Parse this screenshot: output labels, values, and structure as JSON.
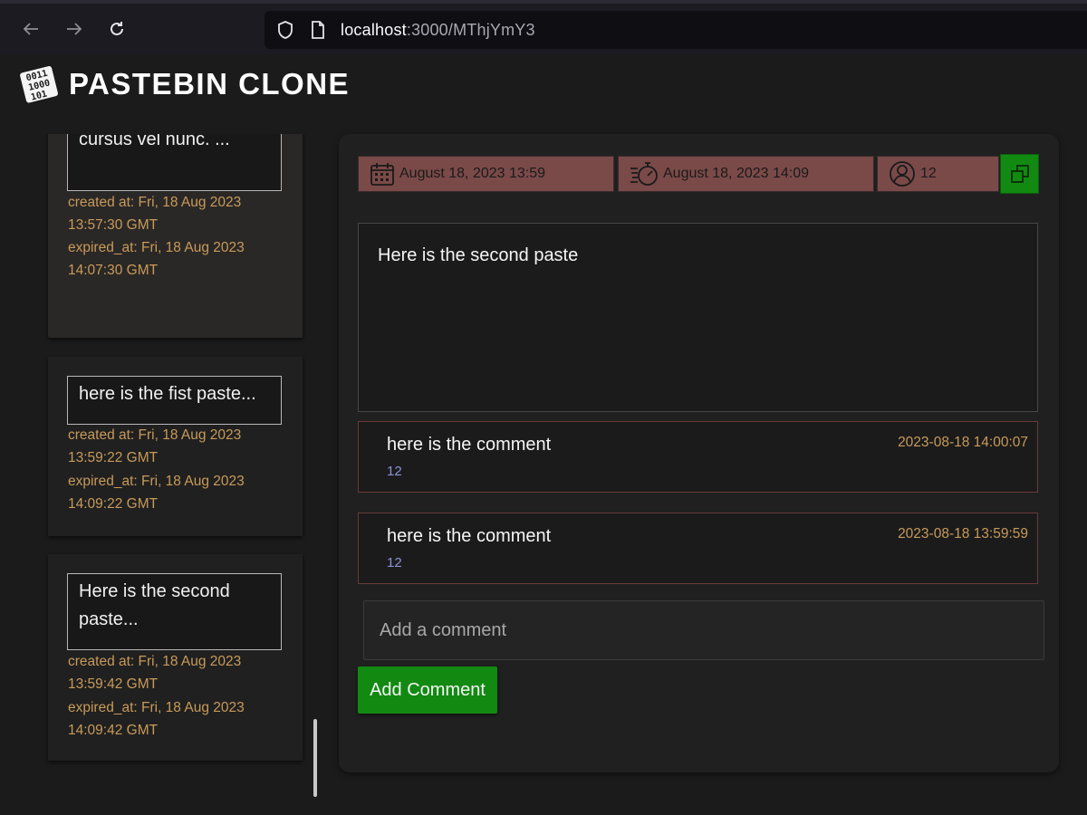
{
  "browser": {
    "url_host": "localhost",
    "url_rest": ":3000/MThjYmY3"
  },
  "header": {
    "logo_text": [
      "0011",
      "1000",
      "101"
    ],
    "title": "PASTEBIN CLONE"
  },
  "sidebar": {
    "cards": [
      {
        "preview": "sodales at aliquam nec, cursus vel nunc. ...",
        "created": "created at: Fri, 18 Aug 2023 13:57:30 GMT",
        "expired": "expired_at: Fri, 18 Aug 2023 14:07:30 GMT"
      },
      {
        "preview": "here is the fist paste...",
        "created": "created at: Fri, 18 Aug 2023 13:59:22 GMT",
        "expired": "expired_at: Fri, 18 Aug 2023 14:09:22 GMT"
      },
      {
        "preview": "Here is the second paste...",
        "created": "created at: Fri, 18 Aug 2023 13:59:42 GMT",
        "expired": "expired_at: Fri, 18 Aug 2023 14:09:42 GMT"
      }
    ]
  },
  "paste": {
    "created_date": "August 18, 2023 13:59",
    "expire_date": "August 18, 2023 14:09",
    "author": "12",
    "content": "Here is the second paste"
  },
  "comments": [
    {
      "text": "here is the comment",
      "author": "12",
      "time": "2023-08-18 14:00:07"
    },
    {
      "text": "here is the comment",
      "author": "12",
      "time": "2023-08-18 13:59:59"
    }
  ],
  "comment_form": {
    "placeholder": "Add a comment",
    "submit_label": "Add Comment"
  },
  "colors": {
    "chip": "#7a4a48",
    "accent_green": "#128a12",
    "meta": "#c89a5a",
    "author": "#8a94d8"
  },
  "icons": {
    "back": "arrow-left-icon",
    "forward": "arrow-right-icon",
    "reload": "reload-icon",
    "shield": "shield-icon",
    "page": "page-icon",
    "calendar": "calendar-icon",
    "timer": "timer-icon",
    "user": "user-icon",
    "copy": "copy-icon"
  }
}
